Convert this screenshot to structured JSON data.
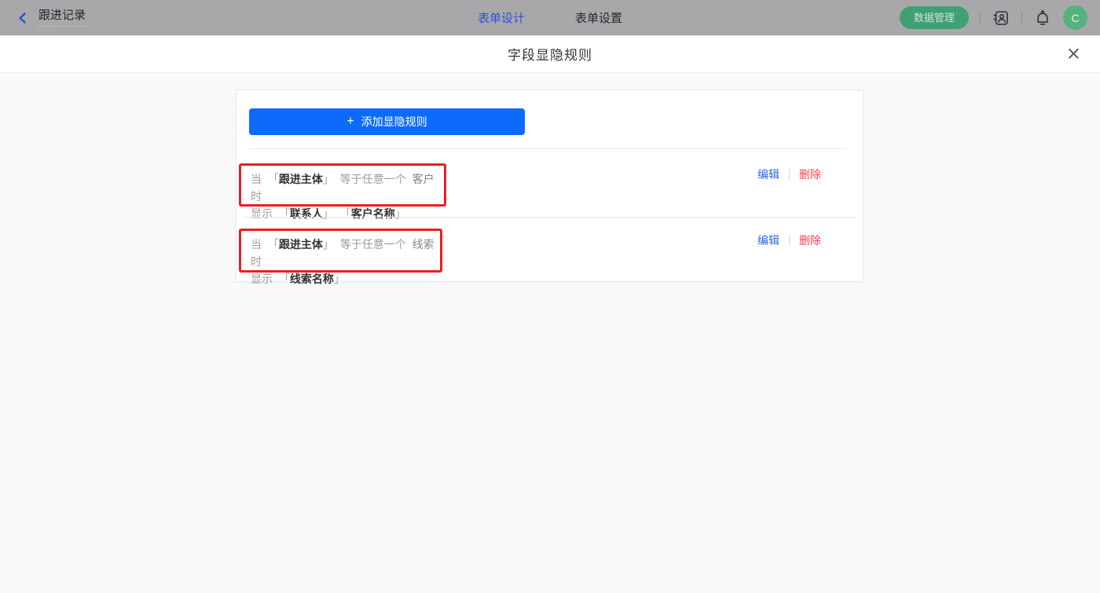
{
  "header": {
    "back_label": "跟进记录",
    "tabs": [
      {
        "label": "表单设计",
        "active": true
      },
      {
        "label": "表单设置",
        "active": false
      }
    ],
    "data_manage_button": "数据管理",
    "avatar_letter": "C"
  },
  "modal": {
    "title": "字段显隐规则",
    "close_glyph": "×",
    "add_button": {
      "plus": "+",
      "label": "添加显隐规则"
    },
    "punct": {
      "open": "「",
      "close": "」"
    },
    "rules": [
      {
        "when": "当",
        "condition_field": "跟进主体",
        "operator": "等于任意一个",
        "value": "客户",
        "suffix": "时",
        "action": "显示",
        "action_fields": [
          "联系人",
          "客户名称"
        ],
        "edit_label": "编辑",
        "delete_label": "删除"
      },
      {
        "when": "当",
        "condition_field": "跟进主体",
        "operator": "等于任意一个",
        "value": "线索",
        "suffix": "时",
        "action": "显示",
        "action_fields": [
          "线索名称"
        ],
        "edit_label": "编辑",
        "delete_label": "删除"
      }
    ]
  },
  "colors": {
    "primary_blue": "#0d6bfb",
    "link_blue": "#2e66d9",
    "delete_red": "#f4434e",
    "annotation_red": "#ee1d1d",
    "pill_green": "#3fa173",
    "avatar_green": "#55b17d",
    "header_bg_dimmed": "#a8a8ab"
  }
}
